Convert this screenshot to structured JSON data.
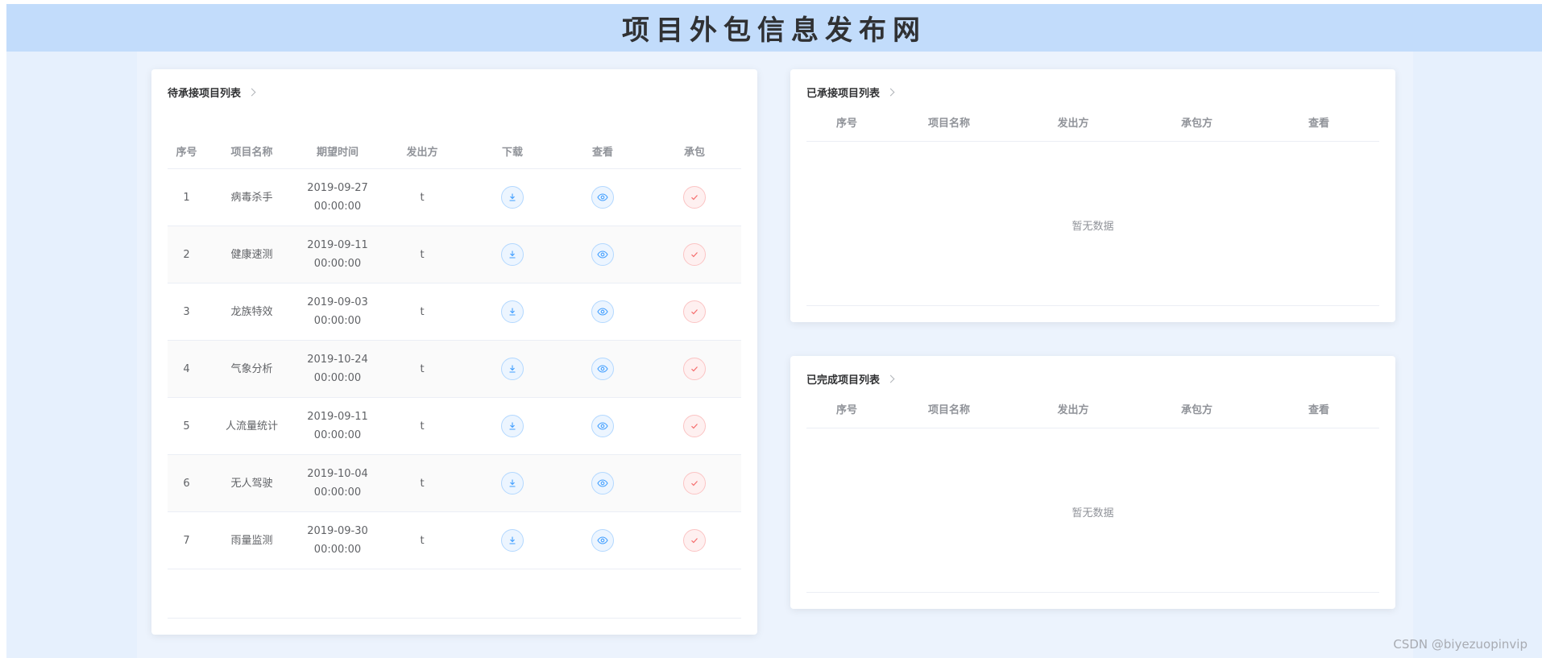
{
  "header": {
    "title": "项目外包信息发布网"
  },
  "pending": {
    "title": "待承接项目列表",
    "columns": [
      "序号",
      "项目名称",
      "期望时间",
      "发出方",
      "下载",
      "查看",
      "承包"
    ],
    "rows": [
      {
        "seq": "1",
        "name": "病毒杀手",
        "date": "2019-09-27",
        "time": "00:00:00",
        "from": "t"
      },
      {
        "seq": "2",
        "name": "健康速测",
        "date": "2019-09-11",
        "time": "00:00:00",
        "from": "t"
      },
      {
        "seq": "3",
        "name": "龙族特效",
        "date": "2019-09-03",
        "time": "00:00:00",
        "from": "t"
      },
      {
        "seq": "4",
        "name": "气象分析",
        "date": "2019-10-24",
        "time": "00:00:00",
        "from": "t"
      },
      {
        "seq": "5",
        "name": "人流量统计",
        "date": "2019-09-11",
        "time": "00:00:00",
        "from": "t"
      },
      {
        "seq": "6",
        "name": "无人驾驶",
        "date": "2019-10-04",
        "time": "00:00:00",
        "from": "t"
      },
      {
        "seq": "7",
        "name": "雨量监测",
        "date": "2019-09-30",
        "time": "00:00:00",
        "from": "t"
      }
    ]
  },
  "accepted": {
    "title": "已承接项目列表",
    "columns": [
      "序号",
      "项目名称",
      "发出方",
      "承包方",
      "查看"
    ],
    "empty_text": "暂无数据"
  },
  "completed": {
    "title": "已完成项目列表",
    "columns": [
      "序号",
      "项目名称",
      "发出方",
      "承包方",
      "查看"
    ],
    "empty_text": "暂无数据"
  },
  "watermark": "CSDN @biyezuopinvip",
  "colors": {
    "header_bg": "#c2dcfb",
    "primary": "#409eff",
    "danger": "#f56c6c"
  },
  "icons": {
    "download": "download-icon",
    "view": "eye-icon",
    "take": "check-icon",
    "more": "chevron-right-icon"
  }
}
